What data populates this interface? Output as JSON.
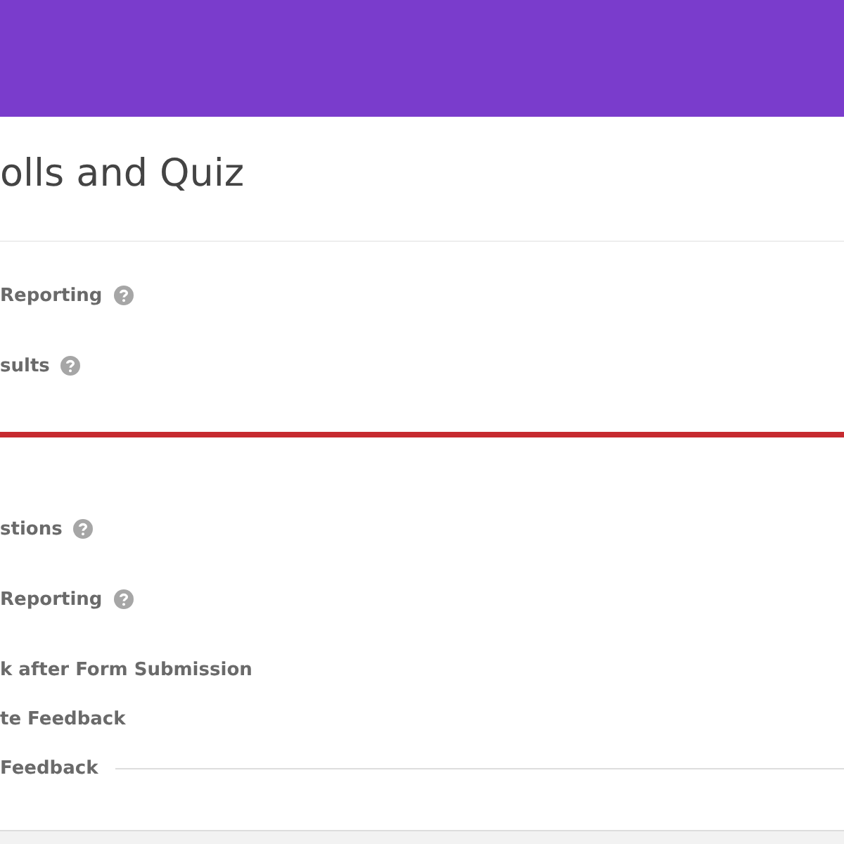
{
  "title": "olls and Quiz",
  "sections": [
    {
      "items": [
        {
          "label": "Reporting",
          "help": true,
          "rule": false
        },
        {
          "label": "sults",
          "help": true,
          "rule": false
        }
      ]
    },
    {
      "items": [
        {
          "label": "stions",
          "help": true,
          "rule": false
        },
        {
          "label": "Reporting",
          "help": true,
          "rule": false
        },
        {
          "label": "k after Form Submission",
          "help": false,
          "rule": false
        },
        {
          "label": "te Feedback",
          "help": false,
          "rule": false
        },
        {
          "label": "Feedback",
          "help": false,
          "rule": true
        }
      ]
    }
  ]
}
